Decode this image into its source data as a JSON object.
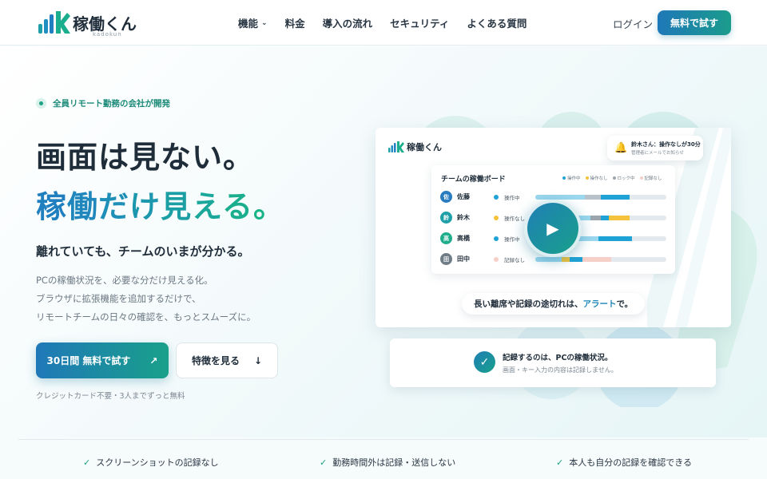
{
  "header": {
    "logo_text": "稼働くん",
    "logo_sub": "kadokun",
    "nav": [
      {
        "label": "機能",
        "dropdown": true
      },
      {
        "label": "料金",
        "dropdown": false
      },
      {
        "label": "導入の流れ",
        "dropdown": false
      },
      {
        "label": "セキュリティ",
        "dropdown": false
      },
      {
        "label": "よくある質問",
        "dropdown": false
      }
    ],
    "login_label": "ログイン",
    "trial_label": "無料で試す"
  },
  "hero": {
    "badge": "全員リモート勤務の会社が開発",
    "headline_1": "画面は見ない。",
    "headline_2": "稼働だけ見える。",
    "subheadline": "離れていても、チームのいまが分かる。",
    "desc_lines": [
      "PCの稼働状況を、必要な分だけ見える化。",
      "ブラウザに拡張機能を追加するだけで、",
      "リモートチームの日々の確認を、もっとスムーズに。"
    ],
    "primary_button": "30日間 無料で試す",
    "primary_icon": "arrow-up-right-icon",
    "secondary_button": "特徴を見る",
    "secondary_icon": "arrow-down-icon",
    "note": "クレジットカード不要・3人までずっと無料"
  },
  "mock": {
    "logo_text": "稼働くん",
    "notification": {
      "title": "鈴木さん：操作なしが30分",
      "body": "管理者にメールでお知らせ",
      "icon": "bell-icon"
    },
    "board": {
      "title": "チームの稼働ボード",
      "legend": [
        {
          "label": "操作中",
          "color": "#1fa2d6"
        },
        {
          "label": "操作なし",
          "color": "#f4c23b"
        },
        {
          "label": "ロック中",
          "color": "#9aa5ae"
        },
        {
          "label": "記録なし",
          "color": "#f7cfc9"
        }
      ],
      "rows": [
        {
          "avatar": "佐",
          "name": "佐藤",
          "status": "操作中",
          "status_color": "#1fa2d6",
          "avatar_color": "#2a7cc0",
          "segments": [
            {
              "start": 0.0,
              "end": 0.38,
              "color": "#9bd7ee"
            },
            {
              "start": 0.38,
              "end": 0.5,
              "color": "#b7c2ca"
            },
            {
              "start": 0.5,
              "end": 0.58,
              "color": "#1fa2d6"
            },
            {
              "start": 0.58,
              "end": 0.72,
              "color": "#1fa2d6"
            }
          ]
        },
        {
          "avatar": "鈴",
          "name": "鈴木",
          "status": "操作なし",
          "status_color": "#f4c23b",
          "avatar_color": "#1fa0a8",
          "segments": [
            {
              "start": 0.0,
              "end": 0.42,
              "color": "#9bd7ee"
            },
            {
              "start": 0.42,
              "end": 0.5,
              "color": "#9aa5ae"
            },
            {
              "start": 0.5,
              "end": 0.56,
              "color": "#1fa2d6"
            },
            {
              "start": 0.56,
              "end": 0.72,
              "color": "#f4c23b"
            }
          ]
        },
        {
          "avatar": "高",
          "name": "高橋",
          "status": "操作中",
          "status_color": "#1fa2d6",
          "avatar_color": "#1fad8c",
          "segments": [
            {
              "start": 0.0,
              "end": 0.48,
              "color": "#9bd7ee"
            },
            {
              "start": 0.48,
              "end": 0.74,
              "color": "#1fa2d6"
            }
          ]
        },
        {
          "avatar": "田",
          "name": "田中",
          "status": "記録なし",
          "status_color": "#f7cfc9",
          "avatar_color": "#6f7c86",
          "segments": [
            {
              "start": 0.0,
              "end": 0.2,
              "color": "#9bd7ee"
            },
            {
              "start": 0.2,
              "end": 0.26,
              "color": "#f4c23b"
            },
            {
              "start": 0.26,
              "end": 0.36,
              "color": "#1fa2d6"
            },
            {
              "start": 0.36,
              "end": 0.58,
              "color": "#f7cfc9"
            }
          ]
        }
      ]
    },
    "play_icon": "play-icon",
    "alert_pre": "長い離席や記録の途切れは、",
    "alert_em": "アラート",
    "alert_post": "で。",
    "record_card": {
      "title": "記録するのは、PCの稼働状況。",
      "body": "画面・キー入力の内容は記録しません。",
      "icon": "check-circle-icon"
    }
  },
  "features": [
    {
      "label": "スクリーンショットの記録なし"
    },
    {
      "label": "勤務時間外は記録・送信しない"
    },
    {
      "label": "本人も自分の記録を確認できる"
    }
  ],
  "colors": {
    "brand_blue": "#1f78b8",
    "brand_green": "#19a08a",
    "text": "#1f2d3a"
  }
}
